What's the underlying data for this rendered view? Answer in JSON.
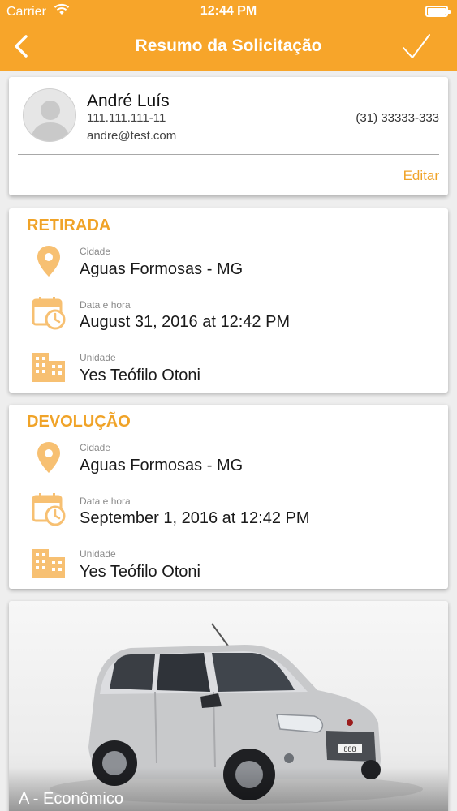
{
  "status_bar": {
    "carrier": "Carrier",
    "time": "12:44 PM"
  },
  "nav": {
    "title": "Resumo da Solicitação",
    "back_icon": "chevron-left-icon",
    "confirm_icon": "checkmark-icon"
  },
  "user": {
    "name": "André Luís",
    "document": "111.111.111-11",
    "email": "andre@test.com",
    "phone": "(31) 33333-333",
    "edit_label": "Editar"
  },
  "pickup": {
    "title": "RETIRADA",
    "city_label": "Cidade",
    "city": "Aguas Formosas - MG",
    "datetime_label": "Data e hora",
    "datetime": "August 31, 2016 at 12:42 PM",
    "unit_label": "Unidade",
    "unit": "Yes Teófilo Otoni"
  },
  "return": {
    "title": "DEVOLUÇÃO",
    "city_label": "Cidade",
    "city": "Aguas Formosas - MG",
    "datetime_label": "Data e hora",
    "datetime": "September 1, 2016 at 12:42 PM",
    "unit_label": "Unidade",
    "unit": "Yes Teófilo Otoni"
  },
  "car": {
    "category": "A - Econômico",
    "plate": "888"
  },
  "colors": {
    "brand": "#f7a52a",
    "accent_text": "#f0a328",
    "icon": "#f7c072"
  }
}
